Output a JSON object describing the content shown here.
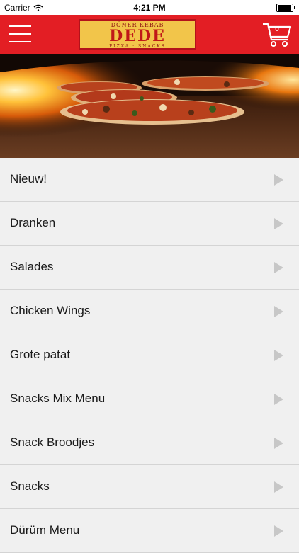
{
  "status_bar": {
    "carrier": "Carrier",
    "time": "4:21 PM",
    "battery_level": 1.0
  },
  "nav_bar": {
    "background_color": "#e31e24",
    "menu_icon": "hamburger-icon",
    "cart_icon": "shopping-cart-icon",
    "cart_count": "0",
    "logo": {
      "top_text": "DÖNER KEBAB",
      "main_text": "DEDE",
      "bottom_text": "PIZZA · SNACKS"
    }
  },
  "hero": {
    "description_icon": "pizza-oven-image"
  },
  "menu": {
    "items": [
      {
        "label": "Nieuw!"
      },
      {
        "label": "Dranken"
      },
      {
        "label": "Salades"
      },
      {
        "label": "Chicken Wings"
      },
      {
        "label": "Grote patat"
      },
      {
        "label": "Snacks Mix Menu"
      },
      {
        "label": "Snack Broodjes"
      },
      {
        "label": "Snacks"
      },
      {
        "label": "Dürüm Menu"
      }
    ],
    "arrow_icon": "chevron-right-icon"
  }
}
